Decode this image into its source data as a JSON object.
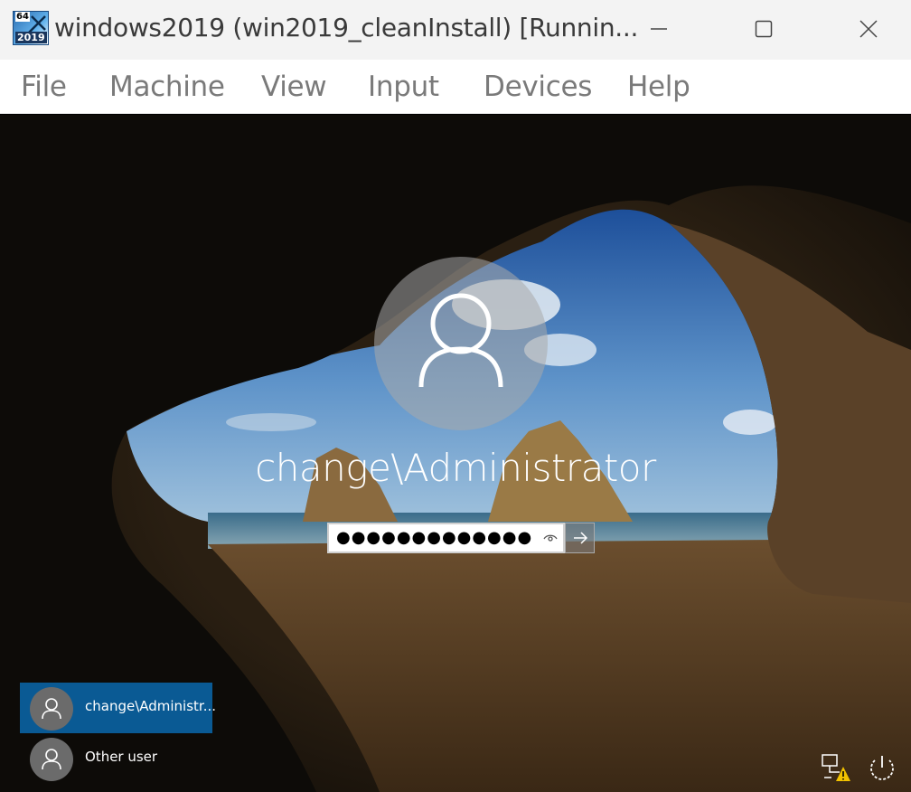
{
  "window": {
    "title": "windows2019 (win2019_cleanInstall) [Runnin...",
    "icon_badge_top": "64",
    "icon_badge_bottom": "2019",
    "controls": [
      "minimize-icon",
      "maximize-icon",
      "close-icon"
    ]
  },
  "menu": {
    "items": [
      {
        "label": "File"
      },
      {
        "label": "Machine"
      },
      {
        "label": "View"
      },
      {
        "label": "Input"
      },
      {
        "label": "Devices"
      },
      {
        "label": "Help"
      }
    ]
  },
  "login": {
    "username": "change\\Administrator",
    "password_value": "●●●●●●●●●●●●●",
    "reveal_icon": "eye-icon",
    "submit_icon": "arrow-right-icon"
  },
  "user_list": [
    {
      "label": "change\\Administr...",
      "selected": true
    },
    {
      "label": "Other user",
      "selected": false
    }
  ],
  "corner_icons": [
    "network-warning-icon",
    "power-icon"
  ],
  "colors": {
    "titlebar_bg": "#f3f3f3",
    "menubar_bg": "#ffffff",
    "selected_tile": "#0a5a94",
    "menu_text": "#7a7a7a"
  }
}
